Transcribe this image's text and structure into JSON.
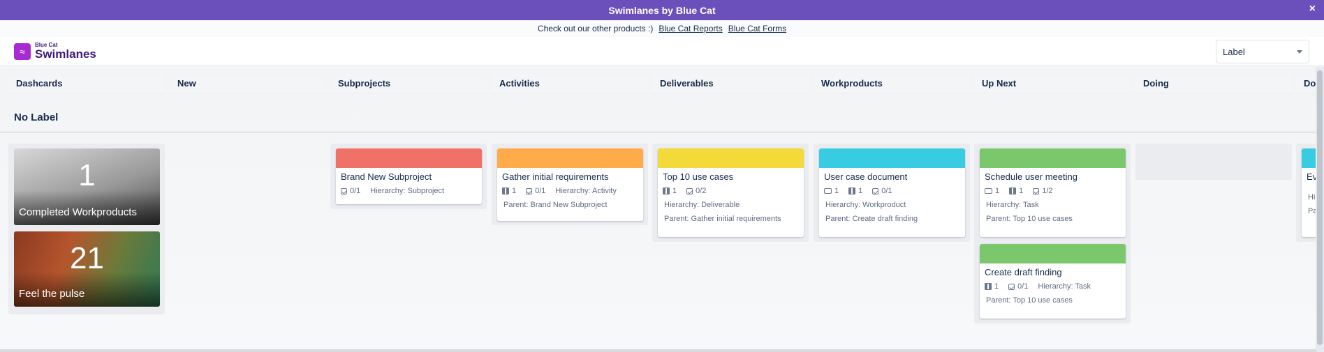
{
  "promo": {
    "title": "Swimlanes by Blue Cat",
    "close_icon": "×"
  },
  "products": {
    "text": "Check out our other products :)",
    "link_reports": "Blue Cat Reports",
    "link_forms": "Blue Cat Forms"
  },
  "logo": {
    "small": "Blue Cat",
    "big": "Swimlanes",
    "icon": "swimmer-icon"
  },
  "group_select": {
    "value": "Label"
  },
  "columns": [
    "Dashcards",
    "New",
    "Subprojects",
    "Activities",
    "Deliverables",
    "Workproducts",
    "Up Next",
    "Doing",
    "Do"
  ],
  "lane": {
    "title": "No Label"
  },
  "dashcards": [
    {
      "number": "1",
      "label": "Completed Workproducts"
    },
    {
      "number": "21",
      "label": "Feel the pulse"
    }
  ],
  "cards": {
    "subproject": {
      "color": "#f07167",
      "title": "Brand New Subproject",
      "checks": "0/1",
      "hierarchy": "Hierarchy: Subproject"
    },
    "activity": {
      "color": "#ffab4a",
      "title": "Gather initial requirements",
      "books": "1",
      "checks": "0/1",
      "hierarchy": "Hierarchy: Activity",
      "parent": "Parent: Brand New Subproject"
    },
    "deliverable": {
      "color": "#f4d93b",
      "title": "Top 10 use cases",
      "books": "1",
      "checks": "0/2",
      "hierarchy": "Hierarchy: Deliverable",
      "parent": "Parent: Gather initial requirements"
    },
    "workproduct": {
      "color": "#38cce3",
      "title": "User case document",
      "comments": "1",
      "books": "1",
      "checks": "0/1",
      "hierarchy": "Hierarchy: Workproduct",
      "parent": "Parent: Create draft finding"
    },
    "task1": {
      "color": "#7bc86c",
      "title": "Schedule user meeting",
      "comments": "1",
      "books": "1",
      "checks": "1/2",
      "hierarchy": "Hierarchy: Task",
      "parent": "Parent: Top 10 use cases"
    },
    "task2": {
      "color": "#7bc86c",
      "title": "Create draft finding",
      "books": "1",
      "checks": "0/1",
      "hierarchy": "Hierarchy: Task",
      "parent": "Parent: Top 10 use cases"
    },
    "partial": {
      "color": "#38cce3",
      "title": "Ev",
      "hierarchy": "Hi",
      "parent": "Pa"
    }
  }
}
